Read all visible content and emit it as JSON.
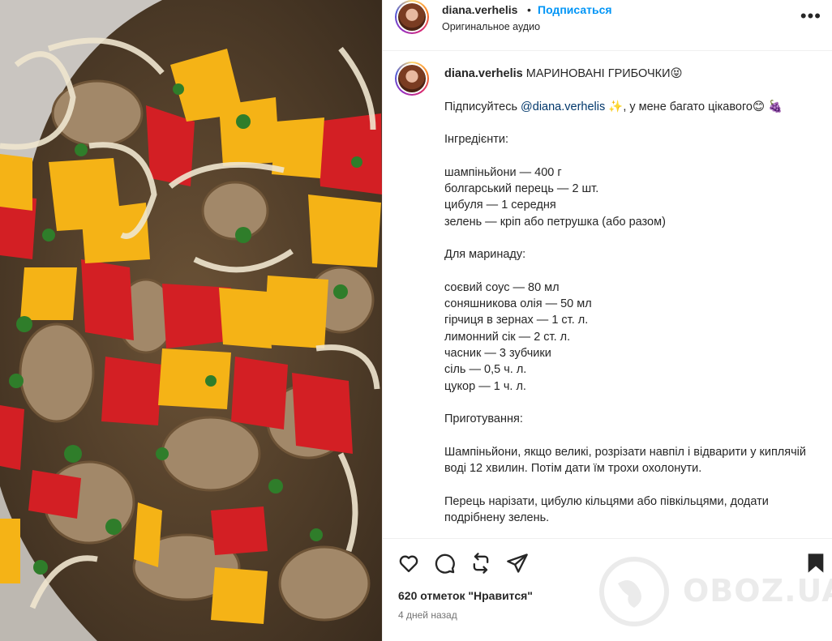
{
  "header": {
    "username": "diana.verhelis",
    "separator": "•",
    "follow_label": "Подписаться",
    "audio_label": "Оригинальное аудио",
    "more_icon": "more-horizontal-icon"
  },
  "caption": {
    "username": "diana.verhelis",
    "title": "МАРИНОВАНІ ГРИБОЧКИ😝",
    "subscribe_prefix": "Підписуйтесь ",
    "mention": "@diana.verhelis",
    "subscribe_suffix": " ✨, у мене багато цікавого😊 🍇",
    "ingredients_title": "Інгредієнти:",
    "ingredients": [
      "шампіньйони — 400 г",
      "болгарський перець — 2 шт.",
      "цибуля — 1 середня",
      "зелень — кріп або петрушка (або разом)"
    ],
    "marinade_title": "Для маринаду:",
    "marinade": [
      "соєвий соус — 80 мл",
      "соняшникова олія — 50 мл",
      "гірчиця в зернах — 1 ст. л.",
      "лимонний сік — 2 ст. л.",
      "часник — 3 зубчики",
      "сіль — 0,5 ч. л.",
      "цукор — 1 ч. л."
    ],
    "cooking_title": "Приготування:",
    "step1": "Шампіньйони, якщо великі, розрізати навпіл і відварити у киплячій воді 12 хвилин. Потім дати їм трохи охолонути.",
    "step2": "Перець нарізати, цибулю кільцями або півкільцями, додати подрібнену зелень."
  },
  "actions": {
    "icons": [
      "heart-icon",
      "comment-icon",
      "repost-icon",
      "share-icon",
      "bookmark-icon"
    ],
    "likes": "620 отметок \"Нравится\"",
    "time": "4 дней назад"
  },
  "watermark": {
    "text": "OBOZ.UA"
  },
  "colors": {
    "link": "#0095f6",
    "mention": "#00376b",
    "text": "#262626",
    "secondary": "#737373",
    "divider": "#efefef"
  }
}
